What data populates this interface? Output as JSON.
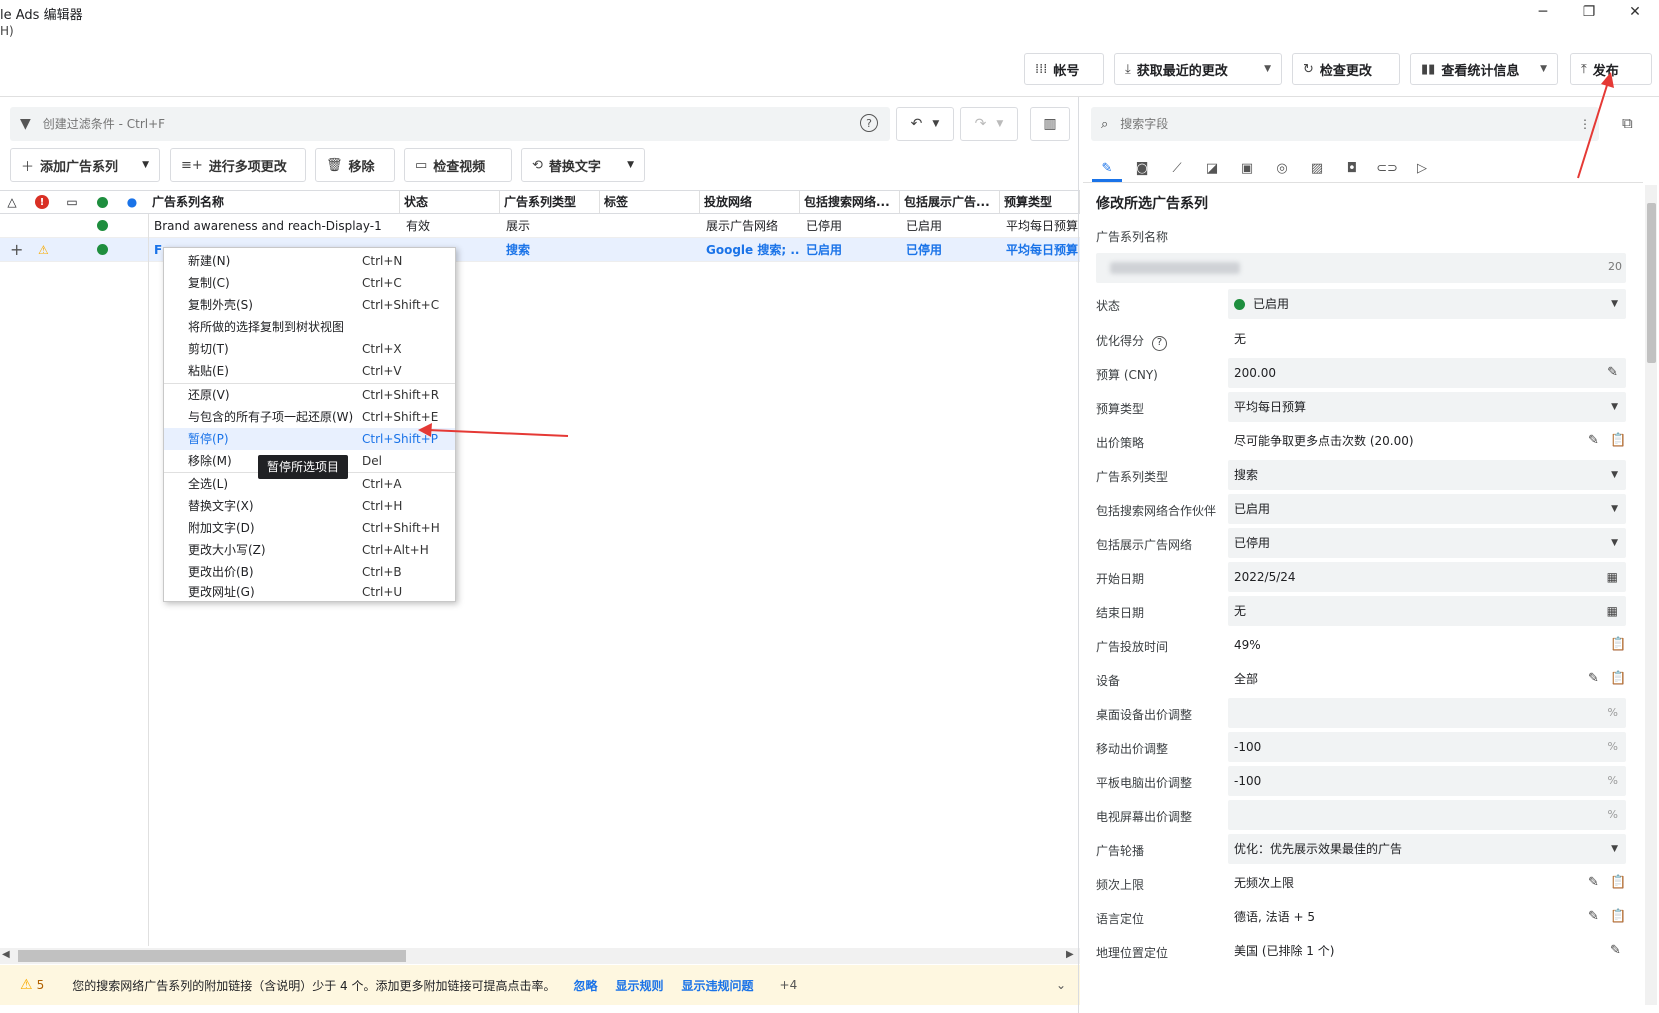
{
  "window": {
    "title": "le Ads 编辑器",
    "menu_help": "H)"
  },
  "toolbar": {
    "account_label": "帐号",
    "get_changes_label": "获取最近的更改",
    "check_changes_label": "检查更改",
    "stats_label": "查看统计信息",
    "publish_label": "发布"
  },
  "filter": {
    "placeholder": "创建过滤条件 - Ctrl+F"
  },
  "actions": {
    "add_campaign": "添加广告系列",
    "multi_change": "进行多项更改",
    "remove": "移除",
    "check_video": "检查视频",
    "replace_text": "替换文字"
  },
  "grid": {
    "columns": [
      "广告系列名称",
      "状态",
      "广告系列类型",
      "标签",
      "投放网络",
      "包括搜索网络...",
      "包括展示广告...",
      "预算类型"
    ],
    "rows": [
      {
        "name": "Brand awareness and reach-Display-1",
        "status": "有效",
        "type": "展示",
        "label": "",
        "network": "展示广告网络",
        "search_partners": "已停用",
        "display_net": "已启用",
        "budget_type": "平均每日预算"
      },
      {
        "name": "F",
        "status": "",
        "type": "搜索",
        "label": "",
        "network": "Google 搜索; ...",
        "search_partners": "已启用",
        "display_net": "已停用",
        "budget_type": "平均每日预算"
      }
    ]
  },
  "context_menu": {
    "items": [
      {
        "label": "新建(N)",
        "shortcut": "Ctrl+N"
      },
      {
        "label": "复制(C)",
        "shortcut": "Ctrl+C"
      },
      {
        "label": "复制外壳(S)",
        "shortcut": "Ctrl+Shift+C"
      },
      {
        "label": "将所做的选择复制到树状视图",
        "shortcut": ""
      },
      {
        "label": "剪切(T)",
        "shortcut": "Ctrl+X"
      },
      {
        "label": "粘贴(E)",
        "shortcut": "Ctrl+V"
      },
      {
        "label": "还原(V)",
        "shortcut": "Ctrl+Shift+R"
      },
      {
        "label": "与包含的所有子项一起还原(W)",
        "shortcut": "Ctrl+Shift+E"
      },
      {
        "label": "暂停(P)",
        "shortcut": "Ctrl+Shift+P"
      },
      {
        "label": "移除(M)",
        "shortcut": "Del"
      },
      {
        "label": "全选(L)",
        "shortcut": "Ctrl+A"
      },
      {
        "label": "替换文字(X)",
        "shortcut": "Ctrl+H"
      },
      {
        "label": "附加文字(D)",
        "shortcut": "Ctrl+Shift+H"
      },
      {
        "label": "更改大小写(Z)",
        "shortcut": "Ctrl+Alt+H"
      },
      {
        "label": "更改出价(B)",
        "shortcut": "Ctrl+B"
      },
      {
        "label": "更改网址(G)",
        "shortcut": "Ctrl+U"
      }
    ],
    "tooltip": "暂停所选项目"
  },
  "warning_bar": {
    "count": "5",
    "message": "您的搜索网络广告系列的附加链接（含说明）少于 4 个。添加更多附加链接可提高点击率。",
    "ignore": "忽略",
    "show_rules": "显示规则",
    "show_violations": "显示违规问题",
    "more": "+4"
  },
  "panel": {
    "search_placeholder": "搜索字段",
    "title": "修改所选广告系列",
    "name_label": "广告系列名称",
    "name_count": "20",
    "fields": [
      {
        "key": "状态",
        "value": "已启用"
      },
      {
        "key": "优化得分",
        "value": "无"
      },
      {
        "key": "预算 (CNY)",
        "value": "200.00"
      },
      {
        "key": "预算类型",
        "value": "平均每日预算"
      },
      {
        "key": "出价策略",
        "value": "尽可能争取更多点击次数 (20.00)"
      },
      {
        "key": "广告系列类型",
        "value": "搜索"
      },
      {
        "key": "包括搜索网络合作伙伴",
        "value": "已启用"
      },
      {
        "key": "包括展示广告网络",
        "value": "已停用"
      },
      {
        "key": "开始日期",
        "value": "2022/5/24"
      },
      {
        "key": "结束日期",
        "value": "无"
      },
      {
        "key": "广告投放时间",
        "value": "49%"
      },
      {
        "key": "设备",
        "value": "全部"
      },
      {
        "key": "桌面设备出价调整",
        "value": ""
      },
      {
        "key": "移动出价调整",
        "value": "-100"
      },
      {
        "key": "平板电脑出价调整",
        "value": "-100"
      },
      {
        "key": "电视屏幕出价调整",
        "value": ""
      },
      {
        "key": "广告轮播",
        "value": "优化：优先展示效果最佳的广告"
      },
      {
        "key": "频次上限",
        "value": "无频次上限"
      },
      {
        "key": "语言定位",
        "value": "德语, 法语 + 5"
      },
      {
        "key": "地理位置定位",
        "value": "美国 (已排除 1 个)"
      }
    ]
  },
  "colors": {
    "accent": "#1a73e8",
    "green": "#1e8e3e",
    "warn_bg": "#fef7e0",
    "annotation_arrow": "#e53935"
  }
}
